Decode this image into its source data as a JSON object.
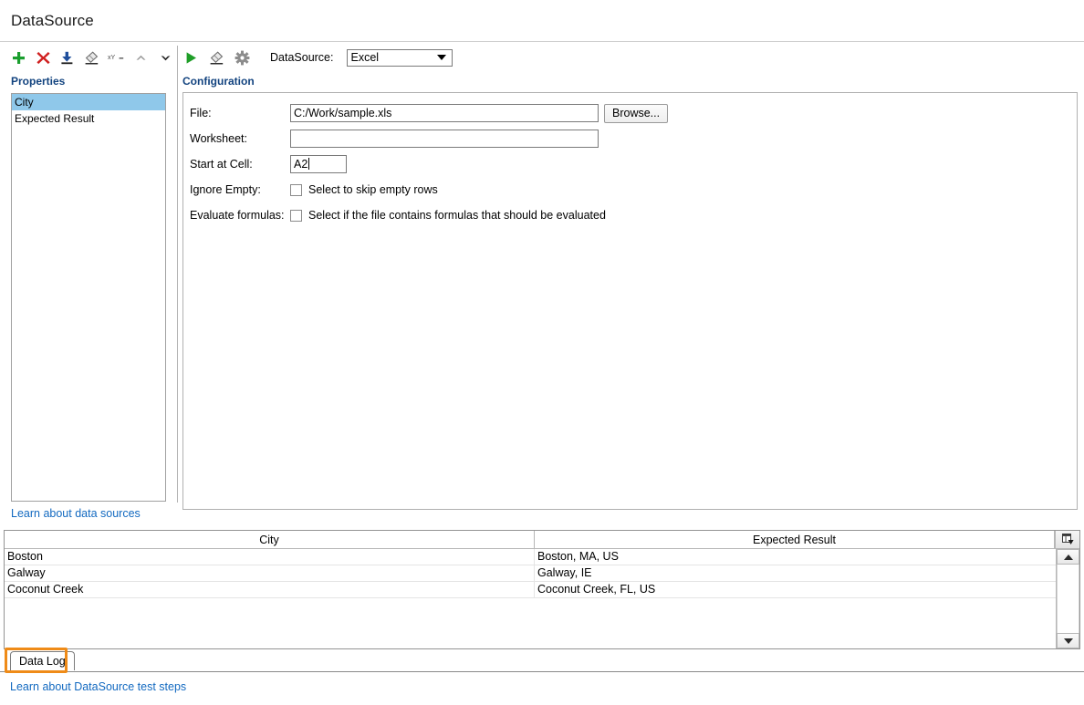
{
  "window": {
    "title": "DataSource"
  },
  "left_panel": {
    "toolbar": [
      {
        "name": "add-property-button",
        "icon": "plus-icon",
        "label": "Add"
      },
      {
        "name": "delete-property-button",
        "icon": "x-delete-icon",
        "label": "Delete"
      },
      {
        "name": "import-property-button",
        "icon": "download-icon",
        "label": "Import"
      },
      {
        "name": "clear-property-button",
        "icon": "eraser-icon",
        "label": "Clear"
      },
      {
        "name": "rename-property-button",
        "icon": "xy-rename-icon",
        "label": "xY_"
      },
      {
        "name": "move-up-button",
        "icon": "chevron-up-icon",
        "label": "Move Up"
      },
      {
        "name": "move-down-button",
        "icon": "chevron-down-icon",
        "label": "Move Down"
      }
    ],
    "heading": "Properties",
    "items": [
      {
        "label": "City",
        "selected": true
      },
      {
        "label": "Expected Result",
        "selected": false
      }
    ],
    "learn_link": "Learn about data sources"
  },
  "right_panel": {
    "toolbar": [
      {
        "name": "run-button",
        "icon": "play-icon",
        "label": "Run"
      },
      {
        "name": "clear-button",
        "icon": "eraser-icon",
        "label": "Clear"
      },
      {
        "name": "settings-button",
        "icon": "gear-icon",
        "label": "Settings"
      }
    ],
    "datasource_label": "DataSource:",
    "datasource_value": "Excel",
    "info_icon": "info-icon",
    "heading": "Configuration",
    "form": {
      "file_label": "File:",
      "file_value": "C:/Work/sample.xls",
      "browse_label": "Browse...",
      "worksheet_label": "Worksheet:",
      "worksheet_value": "",
      "start_cell_label": "Start at Cell:",
      "start_cell_value": "A2",
      "ignore_empty_label": "Ignore Empty:",
      "ignore_empty_text": "Select to skip empty rows",
      "ignore_empty_checked": false,
      "evaluate_formulas_label": "Evaluate formulas:",
      "evaluate_formulas_text": "Select if the file contains formulas that should be evaluated",
      "evaluate_formulas_checked": false
    }
  },
  "grid": {
    "columns": [
      "City",
      "Expected Result"
    ],
    "rows": [
      [
        "Boston",
        "Boston, MA, US"
      ],
      [
        "Galway",
        "Galway, IE"
      ],
      [
        "Coconut Creek",
        "Coconut Creek, FL, US"
      ]
    ],
    "corner_icon": "select-all-icon"
  },
  "footer": {
    "tabs": [
      {
        "label": "Data Log",
        "active": true,
        "highlighted": true
      }
    ],
    "learn_link": "Learn about DataSource test steps"
  },
  "colors": {
    "accent_link": "#1269c0",
    "heading": "#12437f",
    "selection": "#8fc8ea",
    "highlight_box": "#ef8b18",
    "add_green": "#1a9e2e",
    "delete_red": "#d01f1f",
    "import_blue": "#1f5fb5",
    "run_green": "#1f9e28"
  }
}
